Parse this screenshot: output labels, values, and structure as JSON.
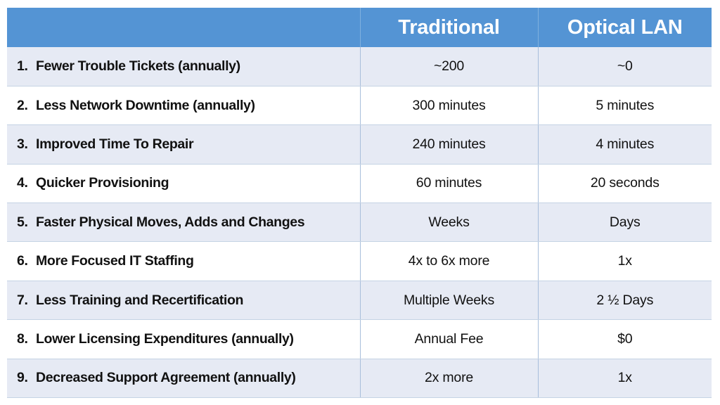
{
  "table": {
    "columns": [
      {
        "key": "benefit",
        "label": ""
      },
      {
        "key": "traditional",
        "label": "Traditional"
      },
      {
        "key": "optical_lan",
        "label": "Optical LAN"
      }
    ],
    "header": {
      "benefit": "",
      "traditional": "Traditional",
      "optical_lan": "Optical LAN"
    },
    "rows": [
      {
        "index": "1.",
        "benefit": "Fewer Trouble Tickets (annually)",
        "traditional": "~200",
        "optical_lan": "~0"
      },
      {
        "index": "2.",
        "benefit": "Less Network Downtime (annually)",
        "traditional": "300 minutes",
        "optical_lan": "5 minutes"
      },
      {
        "index": "3.",
        "benefit": "Improved Time To Repair",
        "traditional": "240 minutes",
        "optical_lan": "4 minutes"
      },
      {
        "index": "4.",
        "benefit": "Quicker Provisioning",
        "traditional": "60 minutes",
        "optical_lan": "20 seconds"
      },
      {
        "index": "5.",
        "benefit": "Faster Physical Moves, Adds and Changes",
        "traditional": "Weeks",
        "optical_lan": "Days"
      },
      {
        "index": "6.",
        "benefit": "More Focused IT Staffing",
        "traditional": "4x to 6x more",
        "optical_lan": "1x"
      },
      {
        "index": "7.",
        "benefit": "Less Training and Recertification",
        "traditional": "Multiple Weeks",
        "optical_lan": "2 ½ Days"
      },
      {
        "index": "8.",
        "benefit": "Lower Licensing Expenditures (annually)",
        "traditional": "Annual Fee",
        "optical_lan": "$0"
      },
      {
        "index": "9.",
        "benefit": "Decreased Support Agreement (annually)",
        "traditional": "2x more",
        "optical_lan": "1x"
      }
    ]
  },
  "colors": {
    "header_background": "#5494D4",
    "header_text": "#FFFFFF",
    "row_shaded_background": "#E6EAF4",
    "row_plain_background": "#FFFFFF",
    "row_divider": "#C5D3E4",
    "column_divider": "#A8BEDB",
    "body_text": "#111111",
    "page_background": "#FFFFFF"
  }
}
